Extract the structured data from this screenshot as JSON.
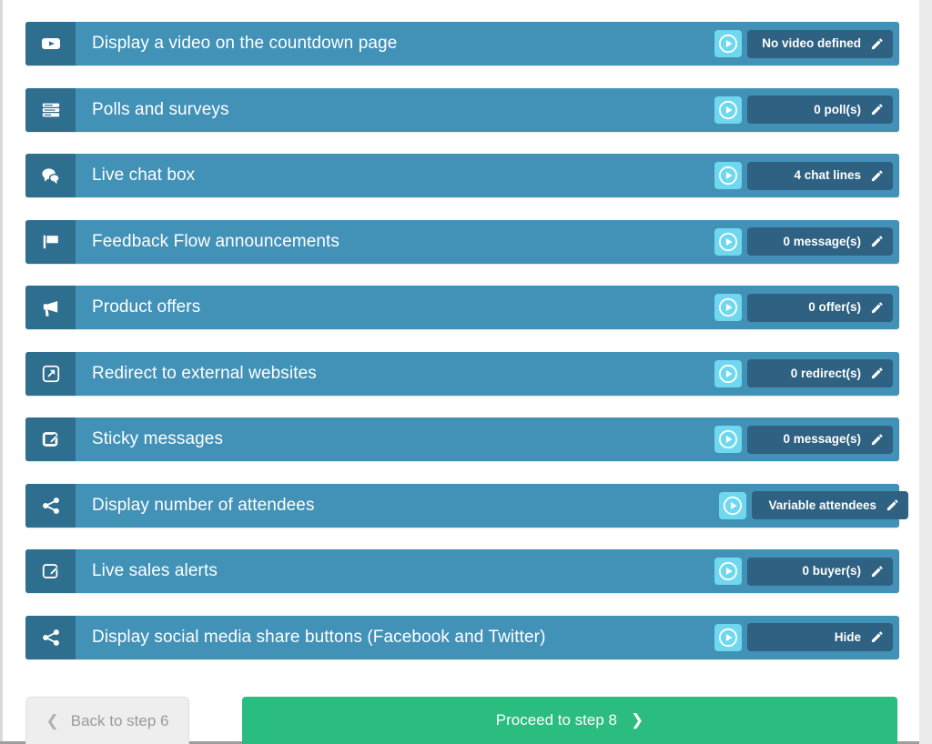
{
  "colors": {
    "row_body": "#4292b8",
    "row_icon_box": "#2e6e8e",
    "play_button": "#6fd8ef",
    "status_badge": "#2e6182",
    "proceed_green": "#2bbc7f",
    "back_grey": "#eeeeee",
    "scroll_gutter": "#ececec"
  },
  "rows": [
    {
      "icon": "video-icon",
      "label": "Display a video on the countdown page",
      "play_icon": "play-circle-icon",
      "status": "No video defined",
      "edit_icon": "pencil-icon"
    },
    {
      "icon": "poll-list-icon",
      "label": "Polls and surveys",
      "play_icon": "play-circle-icon",
      "status": "0 poll(s)",
      "edit_icon": "pencil-icon"
    },
    {
      "icon": "chat-bubbles-icon",
      "label": "Live chat box",
      "play_icon": "play-circle-icon",
      "status": "4 chat lines",
      "edit_icon": "pencil-icon"
    },
    {
      "icon": "flag-icon",
      "label": "Feedback Flow announcements",
      "play_icon": "play-circle-icon",
      "status": "0 message(s)",
      "edit_icon": "pencil-icon"
    },
    {
      "icon": "bullhorn-icon",
      "label": "Product offers",
      "play_icon": "play-circle-icon",
      "status": "0 offer(s)",
      "edit_icon": "pencil-icon"
    },
    {
      "icon": "external-link-square-icon",
      "label": "Redirect to external websites",
      "play_icon": "play-circle-icon",
      "status": "0 redirect(s)",
      "edit_icon": "pencil-icon"
    },
    {
      "icon": "pencil-square-icon",
      "label": "Sticky messages",
      "play_icon": "play-circle-icon",
      "status": "0 message(s)",
      "edit_icon": "pencil-icon"
    },
    {
      "icon": "share-nodes-icon",
      "label": "Display number of attendees",
      "play_icon": "play-circle-icon",
      "status": "Variable attendees",
      "edit_icon": "pencil-icon"
    },
    {
      "icon": "pencil-square-icon",
      "label": "Live sales alerts",
      "play_icon": "play-circle-icon",
      "status": "0 buyer(s)",
      "edit_icon": "pencil-icon"
    },
    {
      "icon": "share-nodes-icon",
      "label": "Display social media share buttons (Facebook and Twitter)",
      "play_icon": "play-circle-icon",
      "status": "Hide",
      "edit_icon": "pencil-icon"
    }
  ],
  "footer": {
    "back_label": "Back to step 6",
    "back_chevron": "chevron-left-icon",
    "proceed_label": "Proceed to step 8",
    "proceed_chevron": "chevron-right-icon"
  }
}
